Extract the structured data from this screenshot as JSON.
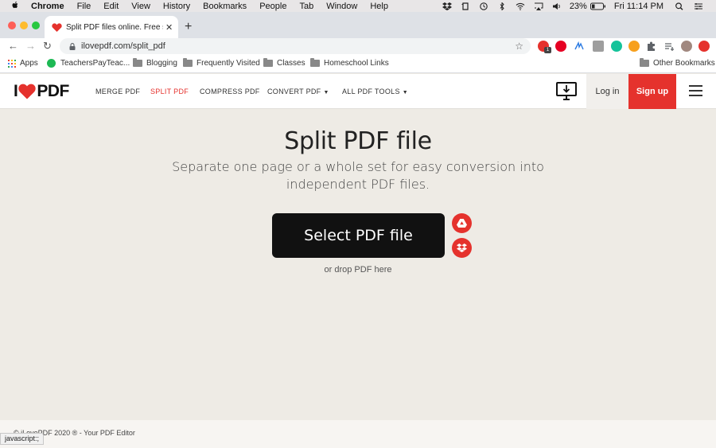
{
  "menubar": {
    "app": "Chrome",
    "items": [
      "File",
      "Edit",
      "View",
      "History",
      "Bookmarks",
      "People",
      "Tab",
      "Window",
      "Help"
    ],
    "battery": "23%",
    "clock": "Fri 11:14 PM"
  },
  "browser": {
    "tab_title": "Split PDF files online. Free serv",
    "url": "ilovepdf.com/split_pdf",
    "extension_badge": "1",
    "bookmarks": [
      "Apps",
      "TeachersPayTeac...",
      "Blogging",
      "Frequently Visited",
      "Classes",
      "Homeschool Links"
    ],
    "other_bookmarks": "Other Bookmarks",
    "status_text": "javascript:;"
  },
  "site": {
    "logo_left": "I",
    "logo_right": "PDF",
    "nav": [
      {
        "label": "MERGE PDF"
      },
      {
        "label": "SPLIT PDF"
      },
      {
        "label": "COMPRESS PDF"
      },
      {
        "label": "CONVERT PDF"
      },
      {
        "label": "ALL PDF TOOLS"
      }
    ],
    "login": "Log in",
    "signup": "Sign up"
  },
  "main": {
    "title": "Split PDF file",
    "subtitle": "Separate one page or a whole set for easy conversion into independent PDF files.",
    "select_button": "Select PDF file",
    "drop_text": "or drop PDF here"
  },
  "footer": {
    "copyright": "© iLovePDF 2020 ® - Your PDF Editor"
  },
  "colors": {
    "brand_red": "#e5322d",
    "page_bg": "#eeebe5",
    "button_dark": "#111111"
  },
  "icons": [
    "apple-icon",
    "dropbox-icon",
    "evernote-icon",
    "time-machine-icon",
    "bluetooth-icon",
    "wifi-icon",
    "airplay-icon",
    "volume-icon",
    "battery-icon",
    "spotlight-search-icon",
    "control-center-icon",
    "heart-favicon-icon",
    "lock-icon",
    "bookmark-star-icon",
    "desktop-download-icon",
    "google-drive-icon",
    "dropbox-upload-icon",
    "hamburger-menu-icon"
  ]
}
